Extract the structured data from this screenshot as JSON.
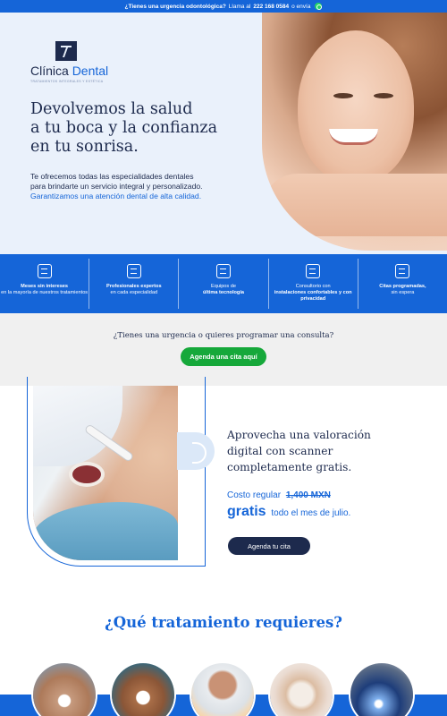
{
  "topbar": {
    "urgent": "¿Tienes una urgencia odontológica?",
    "call_text": "Llama al",
    "phone": "222 168 0584",
    "or_send": "o envía",
    "whatsapp_icon": "whatsapp-icon"
  },
  "logo": {
    "name_part1": "Clínica",
    "name_part2": "Dental",
    "tagline": "TRATAMIENTOS INTEGRALES Y ESTÉTICA"
  },
  "hero": {
    "title_line1": "Devolvemos la salud",
    "title_line2": "a tu boca y la confianza",
    "title_line3": "en tu sonrisa.",
    "desc_line1": "Te ofrecemos todas las especialidades dentales",
    "desc_line2": "para brindarte un servicio integral y personalizado.",
    "desc_strong": "Garantizamos una atención dental de alta calidad."
  },
  "features": [
    {
      "icon": "calendar-card-icon",
      "bold": "Meses sin intereses",
      "text": "en la mayoría de nuestros tratamientos"
    },
    {
      "icon": "dentist-icon",
      "bold": "Profesionales expertos",
      "text": "en cada especialidad"
    },
    {
      "icon": "dental-chair-icon",
      "text_pre": "Equipos de",
      "bold": "última tecnología"
    },
    {
      "icon": "building-icon",
      "text_pre": "Consultorio con",
      "bold": "instalaciones confortables y con privacidad"
    },
    {
      "icon": "schedule-icon",
      "bold": "Citas programadas,",
      "text": "sin espera"
    }
  ],
  "cta": {
    "question": "¿Tienes una urgencia o quieres programar una consulta?",
    "button": "Agenda una cita aquí"
  },
  "scanner": {
    "line1": "Aprovecha una valoración",
    "line2": "digital con scanner",
    "line3": "completamente gratis.",
    "regular_label": "Costo regular",
    "regular_price": "1,400 MXN",
    "gratis": "gratis",
    "gratis_suffix": "todo el mes de julio.",
    "button": "Agenda tu cita"
  },
  "treatments": {
    "title": "¿Qué tratamiento requieres?"
  },
  "colors": {
    "primary": "#1565d8",
    "navy": "#1d2a4d",
    "green": "#16a83a",
    "hero_bg": "#eaf1fb"
  }
}
